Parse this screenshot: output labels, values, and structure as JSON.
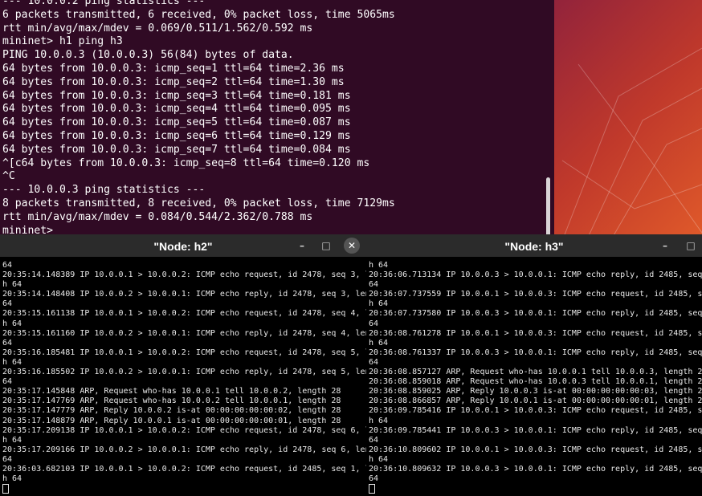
{
  "main_terminal": {
    "lines": [
      "--- 10.0.0.2 ping statistics ---",
      "6 packets transmitted, 6 received, 0% packet loss, time 5065ms",
      "rtt min/avg/max/mdev = 0.069/0.511/1.562/0.592 ms",
      "mininet> h1 ping h3",
      "PING 10.0.0.3 (10.0.0.3) 56(84) bytes of data.",
      "64 bytes from 10.0.0.3: icmp_seq=1 ttl=64 time=2.36 ms",
      "64 bytes from 10.0.0.3: icmp_seq=2 ttl=64 time=1.30 ms",
      "64 bytes from 10.0.0.3: icmp_seq=3 ttl=64 time=0.181 ms",
      "64 bytes from 10.0.0.3: icmp_seq=4 ttl=64 time=0.095 ms",
      "64 bytes from 10.0.0.3: icmp_seq=5 ttl=64 time=0.087 ms",
      "64 bytes from 10.0.0.3: icmp_seq=6 ttl=64 time=0.129 ms",
      "64 bytes from 10.0.0.3: icmp_seq=7 ttl=64 time=0.084 ms",
      "^[c64 bytes from 10.0.0.3: icmp_seq=8 ttl=64 time=0.120 ms",
      "^C",
      "--- 10.0.0.3 ping statistics ---",
      "8 packets transmitted, 8 received, 0% packet loss, time 7129ms",
      "rtt min/avg/max/mdev = 0.084/0.544/2.362/0.788 ms",
      "mininet>"
    ]
  },
  "h2": {
    "title": "\"Node: h2\"",
    "controls": {
      "minimize": "–",
      "maximize": "□",
      "close": "✕"
    },
    "lines": [
      "64",
      "20:35:14.148389 IP 10.0.0.1 > 10.0.0.2: ICMP echo request, id 2478, seq 3, lengt",
      "h 64",
      "20:35:14.148408 IP 10.0.0.2 > 10.0.0.1: ICMP echo reply, id 2478, seq 3, length",
      "64",
      "20:35:15.161138 IP 10.0.0.1 > 10.0.0.2: ICMP echo request, id 2478, seq 4, lengt",
      "h 64",
      "20:35:15.161160 IP 10.0.0.2 > 10.0.0.1: ICMP echo reply, id 2478, seq 4, length",
      "64",
      "20:35:16.185481 IP 10.0.0.1 > 10.0.0.2: ICMP echo request, id 2478, seq 5, lengt",
      "h 64",
      "20:35:16.185502 IP 10.0.0.2 > 10.0.0.1: ICMP echo reply, id 2478, seq 5, length",
      "64",
      "20:35:17.145848 ARP, Request who-has 10.0.0.1 tell 10.0.0.2, length 28",
      "20:35:17.147769 ARP, Request who-has 10.0.0.2 tell 10.0.0.1, length 28",
      "20:35:17.147779 ARP, Reply 10.0.0.2 is-at 00:00:00:00:00:02, length 28",
      "20:35:17.148879 ARP, Reply 10.0.0.1 is-at 00:00:00:00:00:01, length 28",
      "20:35:17.209138 IP 10.0.0.1 > 10.0.0.2: ICMP echo request, id 2478, seq 6, lengt",
      "h 64",
      "20:35:17.209166 IP 10.0.0.2 > 10.0.0.1: ICMP echo reply, id 2478, seq 6, length",
      "64",
      "20:36:03.682103 IP 10.0.0.1 > 10.0.0.2: ICMP echo request, id 2485, seq 1, lengt",
      "h 64"
    ]
  },
  "h3": {
    "title": "\"Node: h3\"",
    "controls": {
      "minimize": "–",
      "maximize": "□"
    },
    "lines": [
      "h 64",
      "20:36:06.713134 IP 10.0.0.3 > 10.0.0.1: ICMP echo reply, id 2485, seq 4, le",
      "64",
      "20:36:07.737559 IP 10.0.0.1 > 10.0.0.3: ICMP echo request, id 2485, seq 5,",
      "h 64",
      "20:36:07.737580 IP 10.0.0.3 > 10.0.0.1: ICMP echo reply, id 2485, seq 5, le",
      "64",
      "20:36:08.761278 IP 10.0.0.1 > 10.0.0.3: ICMP echo request, id 2485, seq 6,",
      "h 64",
      "20:36:08.761337 IP 10.0.0.3 > 10.0.0.1: ICMP echo reply, id 2485, seq 6, le",
      "64",
      "20:36:08.857127 ARP, Request who-has 10.0.0.1 tell 10.0.0.3, length 28",
      "20:36:08.859018 ARP, Request who-has 10.0.0.3 tell 10.0.0.1, length 28",
      "20:36:08.859025 ARP, Reply 10.0.0.3 is-at 00:00:00:00:00:03, length 28",
      "20:36:08.866857 ARP, Reply 10.0.0.1 is-at 00:00:00:00:00:01, length 28",
      "20:36:09.785416 IP 10.0.0.1 > 10.0.0.3: ICMP echo request, id 2485, seq 7,",
      "h 64",
      "20:36:09.785441 IP 10.0.0.3 > 10.0.0.1: ICMP echo reply, id 2485, seq 7, le",
      "64",
      "20:36:10.809602 IP 10.0.0.1 > 10.0.0.3: ICMP echo request, id 2485, seq 8,",
      "h 64",
      "20:36:10.809632 IP 10.0.0.3 > 10.0.0.1: ICMP echo reply, id 2485, seq 8, le",
      "64"
    ]
  }
}
